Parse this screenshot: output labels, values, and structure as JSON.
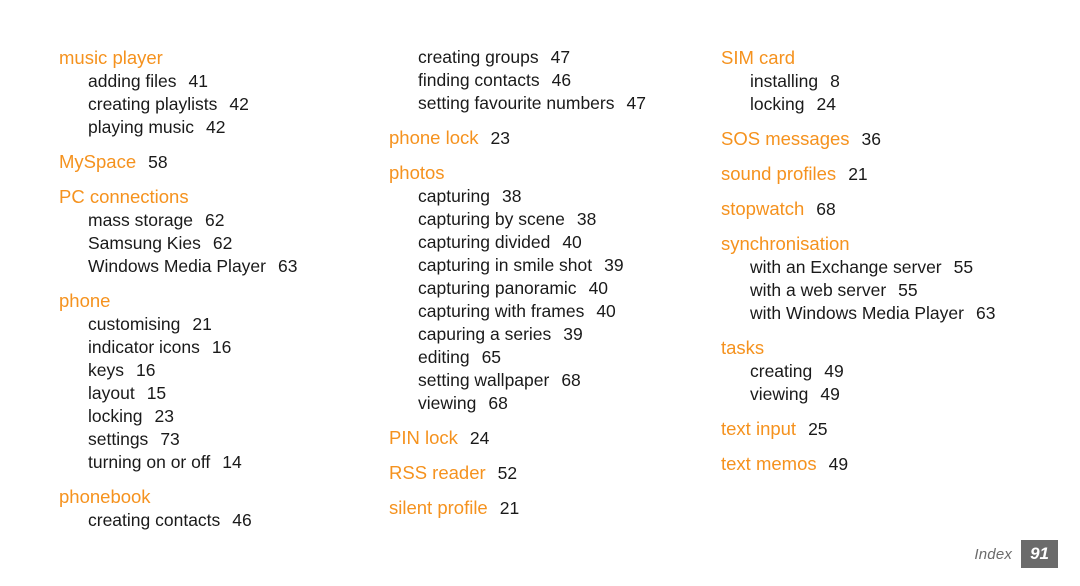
{
  "document": {
    "type": "index",
    "footer": {
      "label": "Index",
      "page_number": "91"
    },
    "colors": {
      "heading": "#F5921E",
      "body": "#1a1a1a",
      "footer_gray": "#6b6b6b",
      "background": "#ffffff"
    }
  },
  "columns": [
    {
      "id": "column-1",
      "groups": [
        {
          "heading": "music player",
          "heading_page": "",
          "entries": [
            {
              "label": "adding files",
              "page": "41"
            },
            {
              "label": "creating playlists",
              "page": "42"
            },
            {
              "label": "playing music",
              "page": "42"
            }
          ]
        },
        {
          "heading": "MySpace",
          "heading_page": "58",
          "entries": []
        },
        {
          "heading": "PC connections",
          "heading_page": "",
          "entries": [
            {
              "label": "mass storage",
              "page": "62"
            },
            {
              "label": "Samsung Kies",
              "page": "62"
            },
            {
              "label": "Windows Media Player",
              "page": "63"
            }
          ]
        },
        {
          "heading": "phone",
          "heading_page": "",
          "entries": [
            {
              "label": "customising",
              "page": "21"
            },
            {
              "label": "indicator icons",
              "page": "16"
            },
            {
              "label": "keys",
              "page": "16"
            },
            {
              "label": "layout",
              "page": "15"
            },
            {
              "label": "locking",
              "page": "23"
            },
            {
              "label": "settings",
              "page": "73"
            },
            {
              "label": "turning on or off",
              "page": "14"
            }
          ]
        },
        {
          "heading": "phonebook",
          "heading_page": "",
          "entries": [
            {
              "label": "creating contacts",
              "page": "46"
            }
          ]
        }
      ]
    },
    {
      "id": "column-2",
      "continuation_entries": [
        {
          "label": "creating groups",
          "page": "47"
        },
        {
          "label": "finding contacts",
          "page": "46"
        },
        {
          "label": "setting favourite numbers",
          "page": "47"
        }
      ],
      "groups": [
        {
          "heading": "phone lock",
          "heading_page": "23",
          "entries": []
        },
        {
          "heading": "photos",
          "heading_page": "",
          "entries": [
            {
              "label": "capturing",
              "page": "38"
            },
            {
              "label": "capturing by scene",
              "page": "38"
            },
            {
              "label": "capturing divided",
              "page": "40"
            },
            {
              "label": "capturing in smile shot",
              "page": "39"
            },
            {
              "label": "capturing panoramic",
              "page": "40"
            },
            {
              "label": "capturing with frames",
              "page": "40"
            },
            {
              "label": "capuring a series",
              "page": "39"
            },
            {
              "label": "editing",
              "page": "65"
            },
            {
              "label": "setting wallpaper",
              "page": "68"
            },
            {
              "label": "viewing",
              "page": "68"
            }
          ]
        },
        {
          "heading": "PIN lock",
          "heading_page": "24",
          "entries": []
        },
        {
          "heading": "RSS reader",
          "heading_page": "52",
          "entries": []
        },
        {
          "heading": "silent profile",
          "heading_page": "21",
          "entries": []
        }
      ]
    },
    {
      "id": "column-3",
      "groups": [
        {
          "heading": "SIM card",
          "heading_page": "",
          "entries": [
            {
              "label": "installing",
              "page": "8"
            },
            {
              "label": "locking",
              "page": "24"
            }
          ]
        },
        {
          "heading": "SOS messages",
          "heading_page": "36",
          "entries": []
        },
        {
          "heading": "sound profiles",
          "heading_page": "21",
          "entries": []
        },
        {
          "heading": "stopwatch",
          "heading_page": "68",
          "entries": []
        },
        {
          "heading": "synchronisation",
          "heading_page": "",
          "entries": [
            {
              "label": "with an Exchange server",
              "page": "55"
            },
            {
              "label": "with a web server",
              "page": "55"
            },
            {
              "label": "with Windows Media Player",
              "page": "63"
            }
          ]
        },
        {
          "heading": "tasks",
          "heading_page": "",
          "entries": [
            {
              "label": "creating",
              "page": "49"
            },
            {
              "label": "viewing",
              "page": "49"
            }
          ]
        },
        {
          "heading": "text input",
          "heading_page": "25",
          "entries": []
        },
        {
          "heading": "text memos",
          "heading_page": "49",
          "entries": []
        }
      ]
    }
  ]
}
